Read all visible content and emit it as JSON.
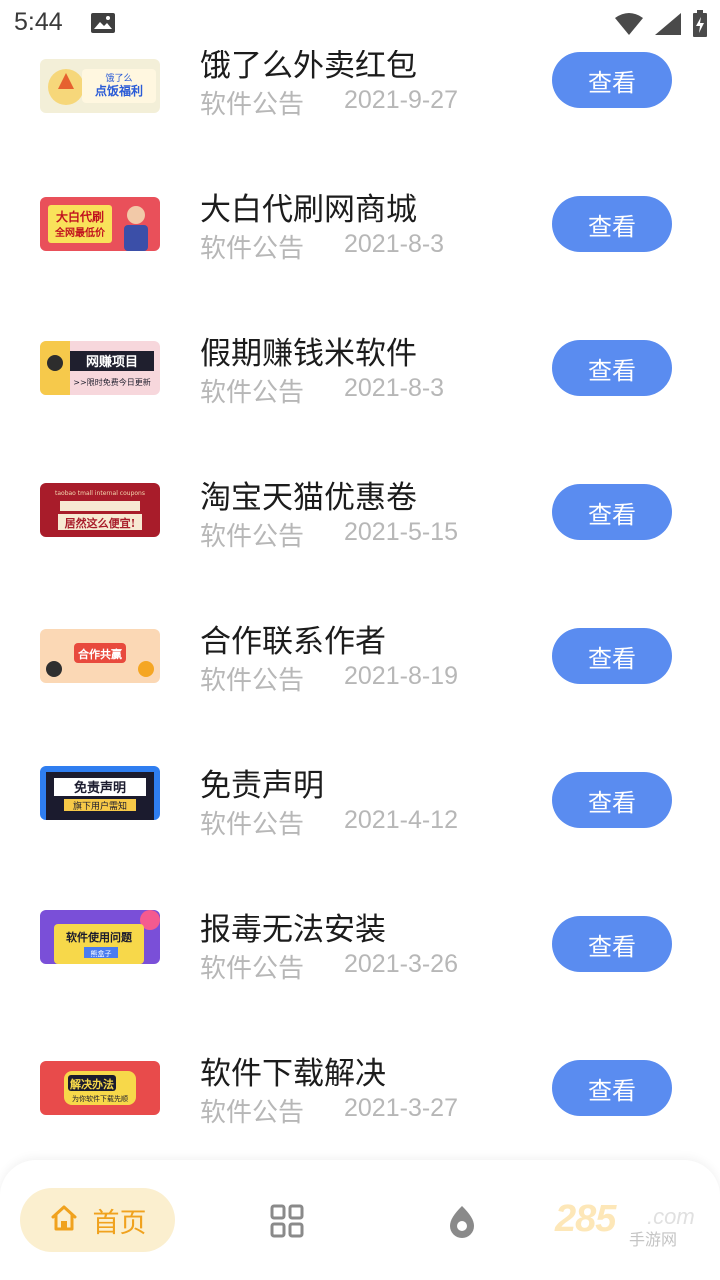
{
  "status_bar": {
    "time": "5:44",
    "icons": [
      "image-icon",
      "wifi-icon",
      "signal-icon",
      "battery-icon"
    ]
  },
  "list": {
    "view_label": "查看",
    "items": [
      {
        "title": "饿了么外卖红包",
        "category": "软件公告",
        "date": "2021-9-27",
        "thumb_text": "点饭福利",
        "thumb_subtext": "饿了么",
        "thumb_color": "#f3efd8"
      },
      {
        "title": "大白代刷网商城",
        "category": "软件公告",
        "date": "2021-8-3",
        "thumb_text": "大白代刷",
        "thumb_subtext": "全网最低价",
        "thumb_color": "#e9505a"
      },
      {
        "title": "假期赚钱米软件",
        "category": "软件公告",
        "date": "2021-8-3",
        "thumb_text": "网赚项目",
        "thumb_subtext": ">>限时免费今日更新",
        "thumb_color": "#f7d7dc"
      },
      {
        "title": "淘宝天猫优惠卷",
        "category": "软件公告",
        "date": "2021-5-15",
        "thumb_text": "居然这么便宜!",
        "thumb_subtext": "taobao tmall internal coupons",
        "thumb_color": "#a81c2a"
      },
      {
        "title": "合作联系作者",
        "category": "软件公告",
        "date": "2021-8-19",
        "thumb_text": "合作共赢",
        "thumb_subtext": "",
        "thumb_color": "#fbd8b5"
      },
      {
        "title": "免责声明",
        "category": "软件公告",
        "date": "2021-4-12",
        "thumb_text": "免责声明",
        "thumb_subtext": "旗下用户需知",
        "thumb_color": "#2f7ef0"
      },
      {
        "title": "报毒无法安装",
        "category": "软件公告",
        "date": "2021-3-26",
        "thumb_text": "软件使用问题",
        "thumb_subtext": "熊盒子",
        "thumb_color": "#7a4fd8"
      },
      {
        "title": "软件下载解决",
        "category": "软件公告",
        "date": "2021-3-27",
        "thumb_text": "解决办法",
        "thumb_subtext": "为你软件下载先顺",
        "thumb_color": "#e84b4b"
      }
    ]
  },
  "bottom_nav": {
    "home_label": "首页",
    "accent_color": "#f0a21e",
    "active_bg": "#fbefcf",
    "items": [
      "home-icon",
      "grid-icon",
      "discover-icon"
    ]
  },
  "watermark": {
    "number": "285",
    "domain": ".com",
    "text": "手游网"
  },
  "colors": {
    "button": "#5a8cf0",
    "title": "#1c1c1c",
    "meta": "#b7b7b7"
  }
}
